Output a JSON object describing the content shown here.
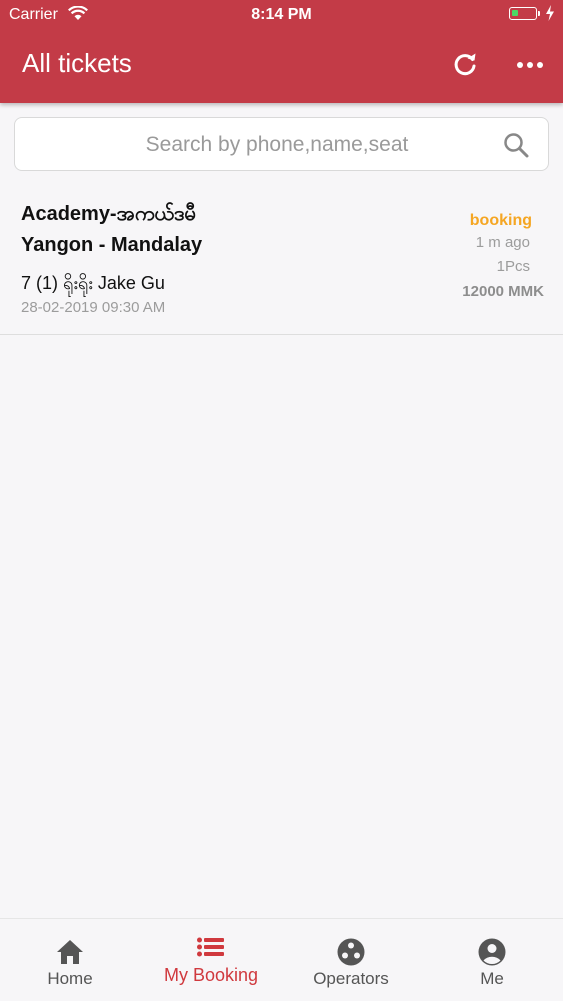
{
  "status_bar": {
    "carrier": "Carrier",
    "time": "8:14 PM",
    "battery_level": 0.3,
    "battery_color": "#4cd964"
  },
  "header": {
    "title": "All tickets",
    "background": "#c33b47",
    "actions": [
      "refresh-icon",
      "more-icon"
    ]
  },
  "search": {
    "placeholder": "Search by phone,name,seat",
    "value": "",
    "icon": "search-icon"
  },
  "tickets": [
    {
      "operator": "Academy-အကယ်ဒမီ",
      "route": "Yangon - Mandalay",
      "seat_info": "7  (1) ရိုးရိုး Jake Gu",
      "departure": "28-02-2019 09:30 AM",
      "status": "booking",
      "status_color": "#f5a623",
      "time_ago": "1 m ago",
      "quantity": "1Pcs",
      "price": "12000 MMK"
    }
  ],
  "tabs": [
    {
      "label": "Home",
      "icon": "home-icon",
      "active": false
    },
    {
      "label": "My Booking",
      "icon": "list-icon",
      "active": true
    },
    {
      "label": "Operators",
      "icon": "operators-icon",
      "active": false
    },
    {
      "label": "Me",
      "icon": "user-icon",
      "active": false
    }
  ],
  "accent_color": "#d0393e"
}
